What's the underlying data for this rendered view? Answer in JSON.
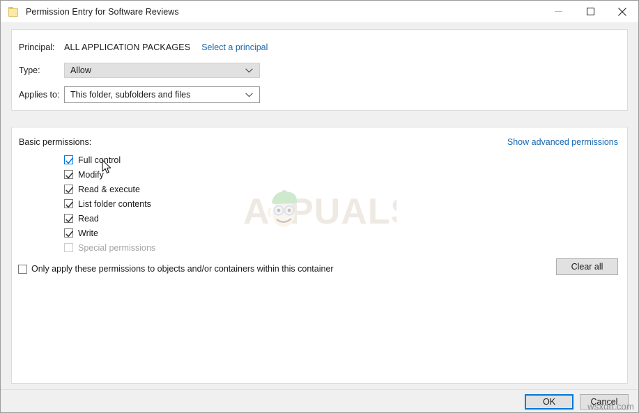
{
  "window": {
    "title": "Permission Entry for Software Reviews",
    "folder_icon": "folder-icon",
    "controls": {
      "minimize": "minimize-icon",
      "maximize": "maximize-icon",
      "close": "close-icon"
    }
  },
  "top_panel": {
    "principal_label": "Principal:",
    "principal_value": "ALL APPLICATION PACKAGES",
    "select_principal_link": "Select a principal",
    "type_label": "Type:",
    "type_value": "Allow",
    "applies_to_label": "Applies to:",
    "applies_to_value": "This folder, subfolders and files"
  },
  "bottom_panel": {
    "basic_permissions_label": "Basic permissions:",
    "show_advanced_link": "Show advanced permissions",
    "permissions": [
      {
        "label": "Full control",
        "checked": true,
        "disabled": false,
        "focused": true
      },
      {
        "label": "Modify",
        "checked": true,
        "disabled": false,
        "focused": false
      },
      {
        "label": "Read & execute",
        "checked": true,
        "disabled": false,
        "focused": false
      },
      {
        "label": "List folder contents",
        "checked": true,
        "disabled": false,
        "focused": false
      },
      {
        "label": "Read",
        "checked": true,
        "disabled": false,
        "focused": false
      },
      {
        "label": "Write",
        "checked": true,
        "disabled": false,
        "focused": false
      },
      {
        "label": "Special permissions",
        "checked": false,
        "disabled": true,
        "focused": false
      }
    ],
    "only_apply_label": "Only apply these permissions to objects and/or containers within this container",
    "only_apply_checked": false,
    "clear_all_label": "Clear all"
  },
  "footer": {
    "ok_label": "OK",
    "cancel_label": "Cancel"
  },
  "watermarks": {
    "appuals": "APPUALS",
    "wsxdn": "wsxdn.com"
  },
  "colors": {
    "link": "#1767b0",
    "focus": "#0078d7",
    "text": "#1a1a1a",
    "disabled_text": "#a6a6a6",
    "panel_bg": "#ffffff",
    "window_bg": "#f0f0f0",
    "combo_gray": "#e1e1e1"
  }
}
